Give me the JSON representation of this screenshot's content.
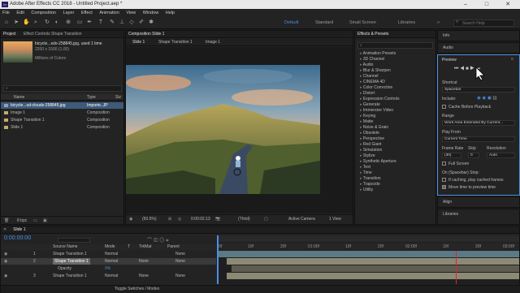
{
  "app": {
    "logo": "Ae",
    "title": "Adobe After Effects CC 2018 - Untitled Project.aep *"
  },
  "menu": [
    "File",
    "Edit",
    "Composition",
    "Layer",
    "Effect",
    "Animation",
    "View",
    "Window",
    "Help"
  ],
  "workspaces": [
    "Default",
    "Standard",
    "Small Screen",
    "Libraries"
  ],
  "search": {
    "placeholder": "Search Help"
  },
  "project": {
    "tabs": [
      "Project",
      "Effect Controls Shape Transition"
    ],
    "thumb_name": "bicycle...sdo-258845.jpg",
    "thumb_used": ", used 1 time",
    "thumb_size": "2200 x 1500 (1.00)",
    "thumb_colors": "Millions of Colors",
    "columns": [
      "Name",
      "Type",
      "Siz"
    ],
    "items": [
      {
        "name": "bicycle...ud-clouds-258845.jpg",
        "type": "Importe..JP",
        "color": "#8aa0c8"
      },
      {
        "name": "Image 1",
        "type": "Composition",
        "color": "#c8a870"
      },
      {
        "name": "Shape Transition 1",
        "type": "Composition",
        "color": "#c8a870"
      },
      {
        "name": "Slide 1",
        "type": "Composition",
        "color": "#c8a870"
      }
    ],
    "bpc": "8 bpc"
  },
  "composition": {
    "tab": "Composition Slide 1",
    "subtabs": [
      "Slide 1",
      "Shape Transition 1",
      "Image 1"
    ],
    "zoom": "(50.5%)",
    "timecode": "0:00:02:13",
    "quality": "(Third)",
    "camera": "Active Camera",
    "views": "1 View"
  },
  "effects": {
    "title": "Effects & Presets",
    "items": [
      "Animation Presets",
      "3D Channel",
      "Audio",
      "Blur & Sharpen",
      "Channel",
      "CINEMA 4D",
      "Color Correction",
      "Distort",
      "Expression Controls",
      "Generate",
      "Immersive Video",
      "Keying",
      "Matte",
      "Noise & Grain",
      "Obsolete",
      "Perspective",
      "Red Giant",
      "Simulation",
      "Stylize",
      "Synthetic Aperture",
      "Text",
      "Time",
      "Transition",
      "Trapcode",
      "Utility"
    ]
  },
  "right": {
    "info": "Info",
    "audio": "Audio",
    "preview": "Preview",
    "shortcut_label": "Shortcut",
    "shortcut_value": "Spacebar",
    "include_label": "Include:",
    "cache": "Cache Before Playback",
    "range_label": "Range",
    "range_value": "Work Area Extended By Current...",
    "play_from_label": "Play From",
    "play_from_value": "Current Time",
    "frame_rate_label": "Frame Rate",
    "skip_label": "Skip",
    "resolution_label": "Resolution",
    "frame_rate_value": "(30)",
    "skip_value": "0",
    "resolution_value": "Auto",
    "full_screen": "Full Screen",
    "stop_label": "On (Spacebar) Stop:",
    "if_caching": "If caching, play cached frames",
    "move_time": "Move time to preview time",
    "align": "Align",
    "libraries": "Libraries"
  },
  "timeline": {
    "tab": "Slide 1",
    "timecode": "0:00:00:00",
    "headers": [
      "Source Name",
      "Mode",
      "T",
      "TrkMat",
      "Parent"
    ],
    "layers": [
      {
        "num": "1",
        "name": "Shape Transition 1",
        "mode": "Normal",
        "parent": "None"
      },
      {
        "num": "2",
        "name": "Shape Transition 1",
        "mode": "Normal",
        "trk": "None",
        "parent": "None"
      },
      {
        "num": "",
        "name": "Opacity",
        "mode": "0%",
        "parent": ""
      },
      {
        "num": "3",
        "name": "Shape Transition 1",
        "mode": "Normal",
        "trk": "None",
        "parent": "None"
      }
    ],
    "ruler": [
      "0f",
      "10f",
      "20f",
      "01:00f",
      "10f",
      "20f",
      "02:00f",
      "10f",
      "20f",
      "03:00f"
    ],
    "footer": "Toggle Switches / Modes"
  }
}
